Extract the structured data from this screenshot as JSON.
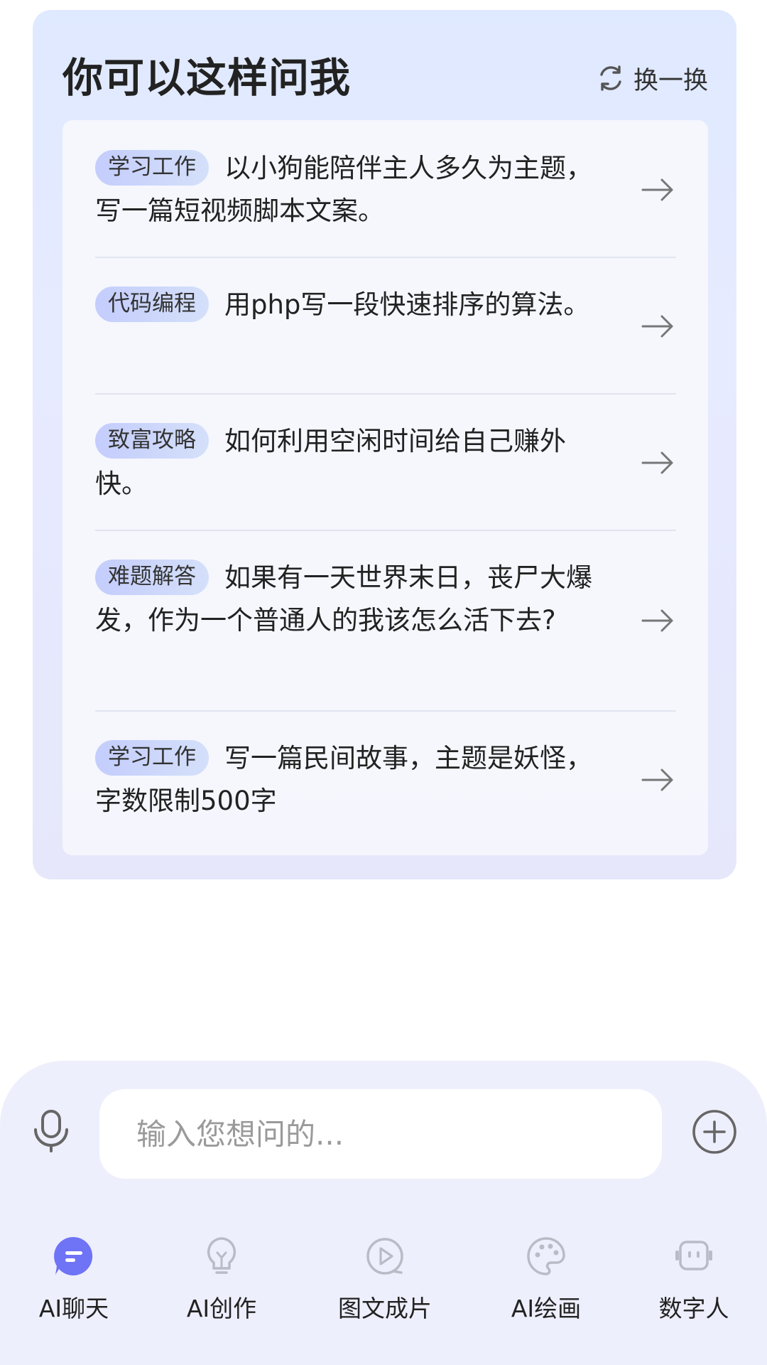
{
  "suggestions_card": {
    "title": "你可以这样问我",
    "refresh_label": "换一换",
    "items": [
      {
        "tag": "学习工作",
        "text": "以小狗能陪伴主人多久为主题，写一篇短视频脚本文案。"
      },
      {
        "tag": "代码编程",
        "text": "用php写一段快速排序的算法。"
      },
      {
        "tag": "致富攻略",
        "text": "如何利用空闲时间给自己赚外快。"
      },
      {
        "tag": "难题解答",
        "text": "如果有一天世界末日，丧尸大爆发，作为一个普通人的我该怎么活下去?"
      },
      {
        "tag": "学习工作",
        "text": "写一篇民间故事，主题是妖怪，字数限制500字"
      }
    ]
  },
  "input": {
    "placeholder": "输入您想问的...",
    "value": ""
  },
  "tabs": [
    {
      "label": "AI聊天",
      "icon": "chat-bubble-icon",
      "active": true
    },
    {
      "label": "AI创作",
      "icon": "lightbulb-icon",
      "active": false
    },
    {
      "label": "图文成片",
      "icon": "play-icon",
      "active": false
    },
    {
      "label": "AI绘画",
      "icon": "palette-icon",
      "active": false
    },
    {
      "label": "数字人",
      "icon": "robot-face-icon",
      "active": false
    }
  ],
  "colors": {
    "accent": "#6f73f6",
    "icon_inactive": "#b9bcc6",
    "chip_gradient_start": "#c4cdfc",
    "chip_gradient_end": "#d4e0fa",
    "card_bg": "#e2eaff",
    "bottom_bg": "#eeeffc"
  }
}
